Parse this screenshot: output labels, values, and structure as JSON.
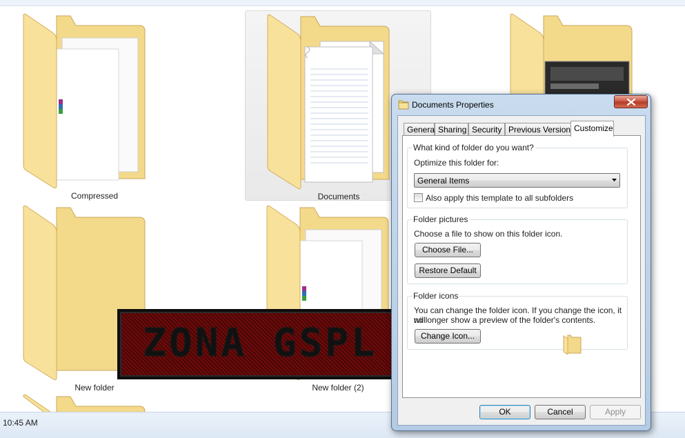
{
  "explorer": {
    "folders": [
      {
        "label": "Compressed",
        "selected": false
      },
      {
        "label": "Documents",
        "selected": true
      },
      {
        "label": "",
        "selected": false
      },
      {
        "label": "New folder",
        "selected": false
      },
      {
        "label": "New folder (2)",
        "selected": false
      },
      {
        "label": "",
        "selected": false
      }
    ]
  },
  "watermark": {
    "text": "ZONA GSPL"
  },
  "statusbar": {
    "text": "10:45 AM"
  },
  "dialog": {
    "title": "Documents Properties",
    "close_icon": "close-icon",
    "tabs": [
      {
        "label": "General",
        "active": false
      },
      {
        "label": "Sharing",
        "active": false
      },
      {
        "label": "Security",
        "active": false
      },
      {
        "label": "Previous Versions",
        "active": false
      },
      {
        "label": "Customize",
        "active": true
      }
    ],
    "folder_type": {
      "title": "What kind of folder do you want?",
      "optimize_label": "Optimize this folder for:",
      "selected_value": "General Items",
      "apply_subfolders_label": "Also apply this template to all subfolders",
      "apply_subfolders_checked": false
    },
    "folder_pictures": {
      "title": "Folder pictures",
      "description": "Choose a file to show on this folder icon.",
      "choose_file_label": "Choose File...",
      "restore_default_label": "Restore Default"
    },
    "folder_icons": {
      "title": "Folder icons",
      "description_line1": "You can change the folder icon. If you change the icon, it will",
      "description_line2": "no longer show a preview of the folder's contents.",
      "change_icon_label": "Change Icon..."
    },
    "buttons": {
      "ok": "OK",
      "cancel": "Cancel",
      "apply": "Apply"
    }
  }
}
